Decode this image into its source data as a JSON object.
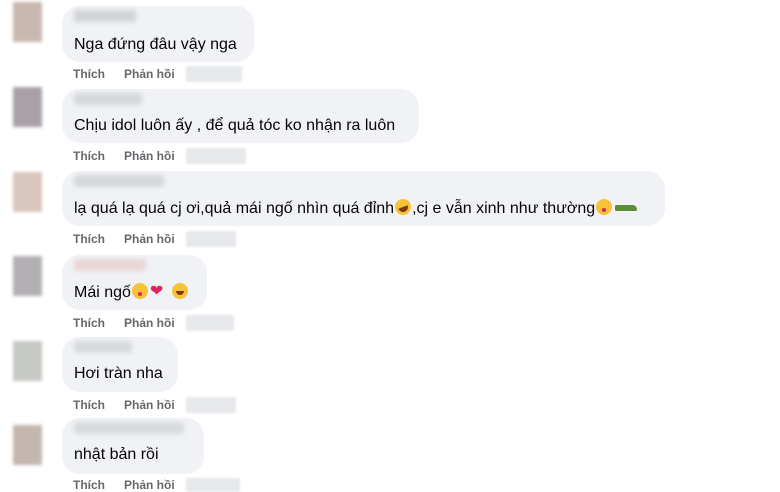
{
  "actions": {
    "like": "Thích",
    "reply": "Phản hồi"
  },
  "comments": [
    {
      "text": "Nga đứng đâu vậy nga",
      "emojis": []
    },
    {
      "text": "Chịu idol luôn ấy , để quả tóc ko nhận ra luôn",
      "emojis": []
    },
    {
      "text": "lạ quá lạ quá cj ơi,quả mái ngố nhìn quá đỉnh",
      "text_after": ",cj e vẫn xinh như thường",
      "emojis": [
        "laughing-emoji",
        "kissing-emoji",
        "crocodile-emoji"
      ]
    },
    {
      "text": "Mái ngố",
      "emojis": [
        "kissing-emoji",
        "hearts-emoji",
        "smile-emoji"
      ]
    },
    {
      "text": "Hơi tràn nha",
      "emojis": []
    },
    {
      "text": "nhật bản rồi",
      "emojis": []
    }
  ]
}
